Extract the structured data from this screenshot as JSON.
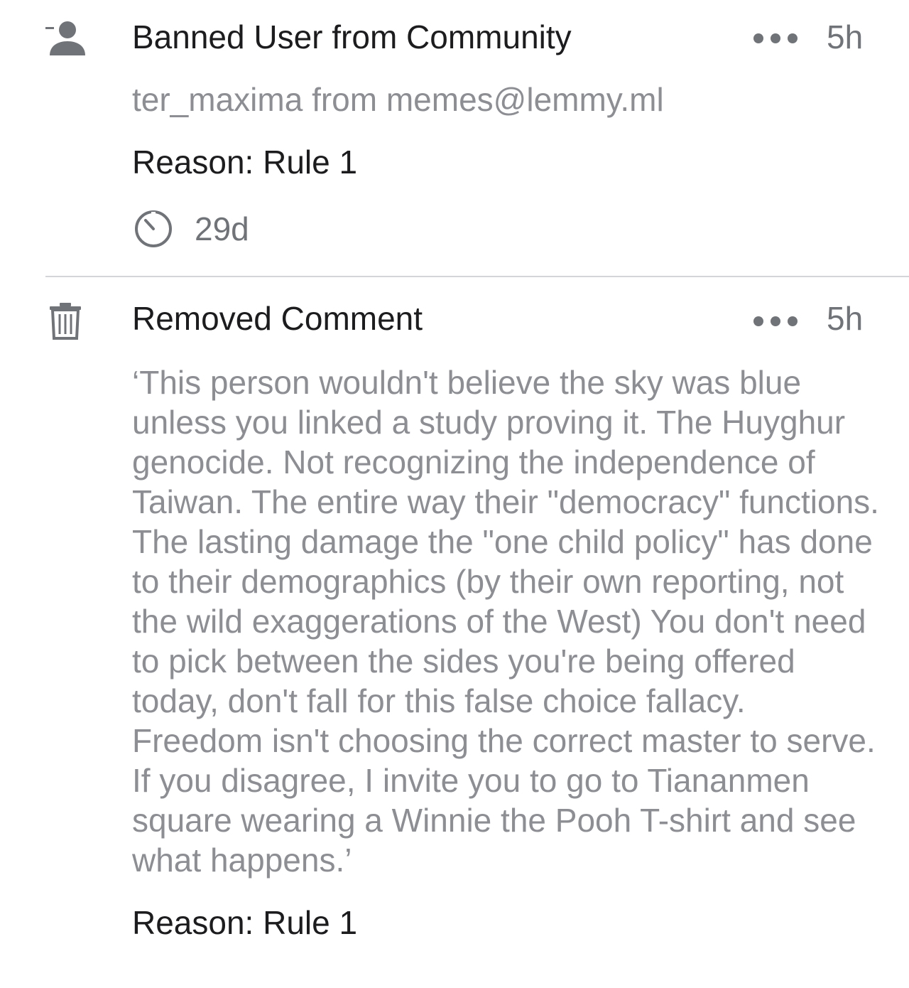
{
  "entries": [
    {
      "type": "ban",
      "icon": "remove-user-icon",
      "title": "Banned User from Community",
      "time": "5h",
      "subtitle": "ter_maxima from memes@lemmy.ml",
      "reason": "Reason: Rule 1",
      "expiry_icon": "timer-icon",
      "expiry": "29d"
    },
    {
      "type": "removed-comment",
      "icon": "trash-icon",
      "title": "Removed Comment",
      "time": "5h",
      "body": "‘This person wouldn't believe the sky was blue unless you linked a study proving it. The Huyghur genocide. Not recognizing the independence of Taiwan. The entire way their \"democracy\" functions. The lasting damage the \"one child policy\" has done to their demographics (by their own reporting, not the wild exaggerations of the West) You don't need to pick between the sides you're being offered today, don't fall for this false choice fallacy. Freedom isn't choosing the correct master to serve. If you disagree, I invite you to go to Tiananmen square wearing a Winnie the Pooh T-shirt and see what happens.’",
      "reason": "Reason: Rule 1"
    }
  ],
  "colors": {
    "primary_text": "#1c1c1e",
    "secondary_text": "#8c8e93",
    "icon_gray": "#707378",
    "divider": "#d4d5d8"
  }
}
